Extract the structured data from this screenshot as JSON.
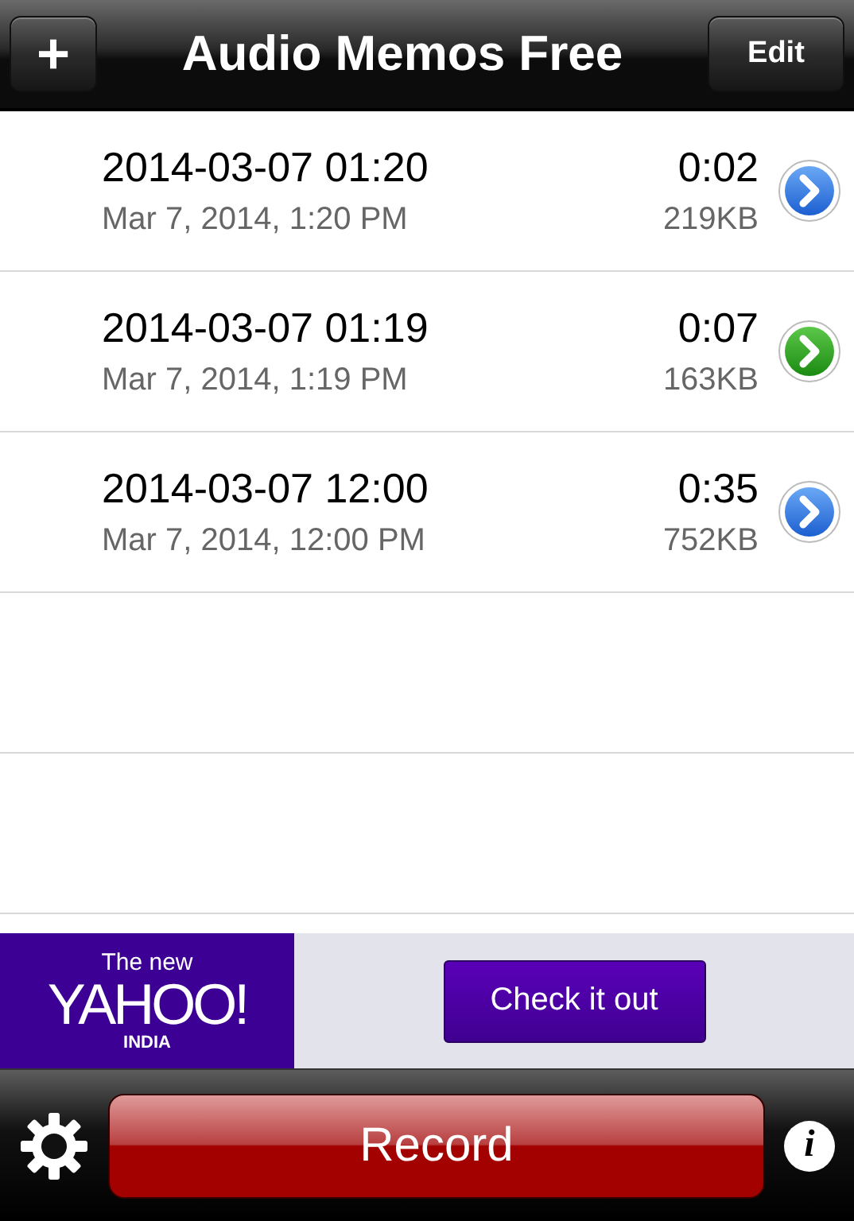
{
  "nav_bar": {
    "add_button": "+",
    "title": "Audio Memos Free",
    "edit_button": "Edit"
  },
  "memos": [
    {
      "name": "2014-03-07 01:20",
      "date": "Mar 7, 2014, 1:20 PM",
      "duration": "0:02",
      "size": "219KB",
      "selected": false
    },
    {
      "name": "2014-03-07 01:19",
      "date": "Mar 7, 2014, 1:19 PM",
      "duration": "0:07",
      "size": "163KB",
      "selected": true
    },
    {
      "name": "2014-03-07 12:00",
      "date": "Mar 7, 2014, 12:00 PM",
      "duration": "0:35",
      "size": "752KB",
      "selected": false
    }
  ],
  "ad": {
    "logo_top": "The new",
    "logo_main": "YAHOO!",
    "logo_bottom": "INDIA",
    "button": "Check it out"
  },
  "toolbar": {
    "record_button": "Record",
    "info_button": "i"
  }
}
